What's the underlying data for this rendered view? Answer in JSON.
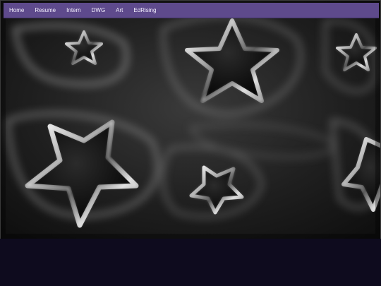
{
  "nav": {
    "links": [
      {
        "label": "Home"
      },
      {
        "label": "Resume"
      },
      {
        "label": "Intern"
      },
      {
        "label": "DWG"
      },
      {
        "label": "Art"
      },
      {
        "label": "EdRising"
      }
    ]
  },
  "hero": {
    "image": "chrome-stars-background",
    "accent_color": "#5e4a8c",
    "background_color": "#0e0b1e"
  }
}
